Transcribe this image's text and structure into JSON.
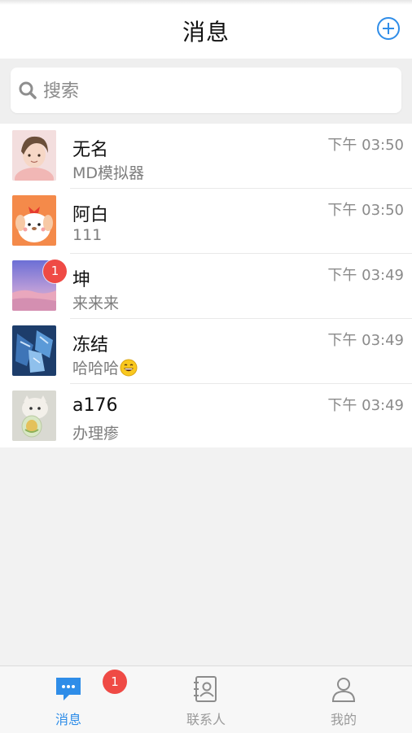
{
  "header": {
    "title": "消息",
    "add_icon": "plus-circle-icon"
  },
  "search": {
    "placeholder": "搜索",
    "value": "",
    "icon": "search-icon"
  },
  "conversations": [
    {
      "name": "无名",
      "preview": "MD模拟器",
      "time": "下午 03:50",
      "badge": ""
    },
    {
      "name": "阿白",
      "preview": "111",
      "time": "下午 03:50",
      "badge": ""
    },
    {
      "name": "坤",
      "preview": "来来来",
      "time": "下午 03:49",
      "badge": "1"
    },
    {
      "name": "冻结",
      "preview": "哈哈哈",
      "time": "下午 03:49",
      "badge": "",
      "emoji": "grinning-face-emoji"
    },
    {
      "name": "a176",
      "preview": "办理瘆",
      "time": "下午 03:49",
      "badge": ""
    }
  ],
  "tabbar": {
    "tabs": [
      {
        "label": "消息",
        "icon": "message-bubble-icon",
        "active": true,
        "badge": "1"
      },
      {
        "label": "联系人",
        "icon": "contacts-book-icon",
        "active": false
      },
      {
        "label": "我的",
        "icon": "person-icon",
        "active": false
      }
    ]
  },
  "colors": {
    "accent": "#2f8de8",
    "badge": "#ef4a45",
    "background": "#f2f2f2"
  }
}
